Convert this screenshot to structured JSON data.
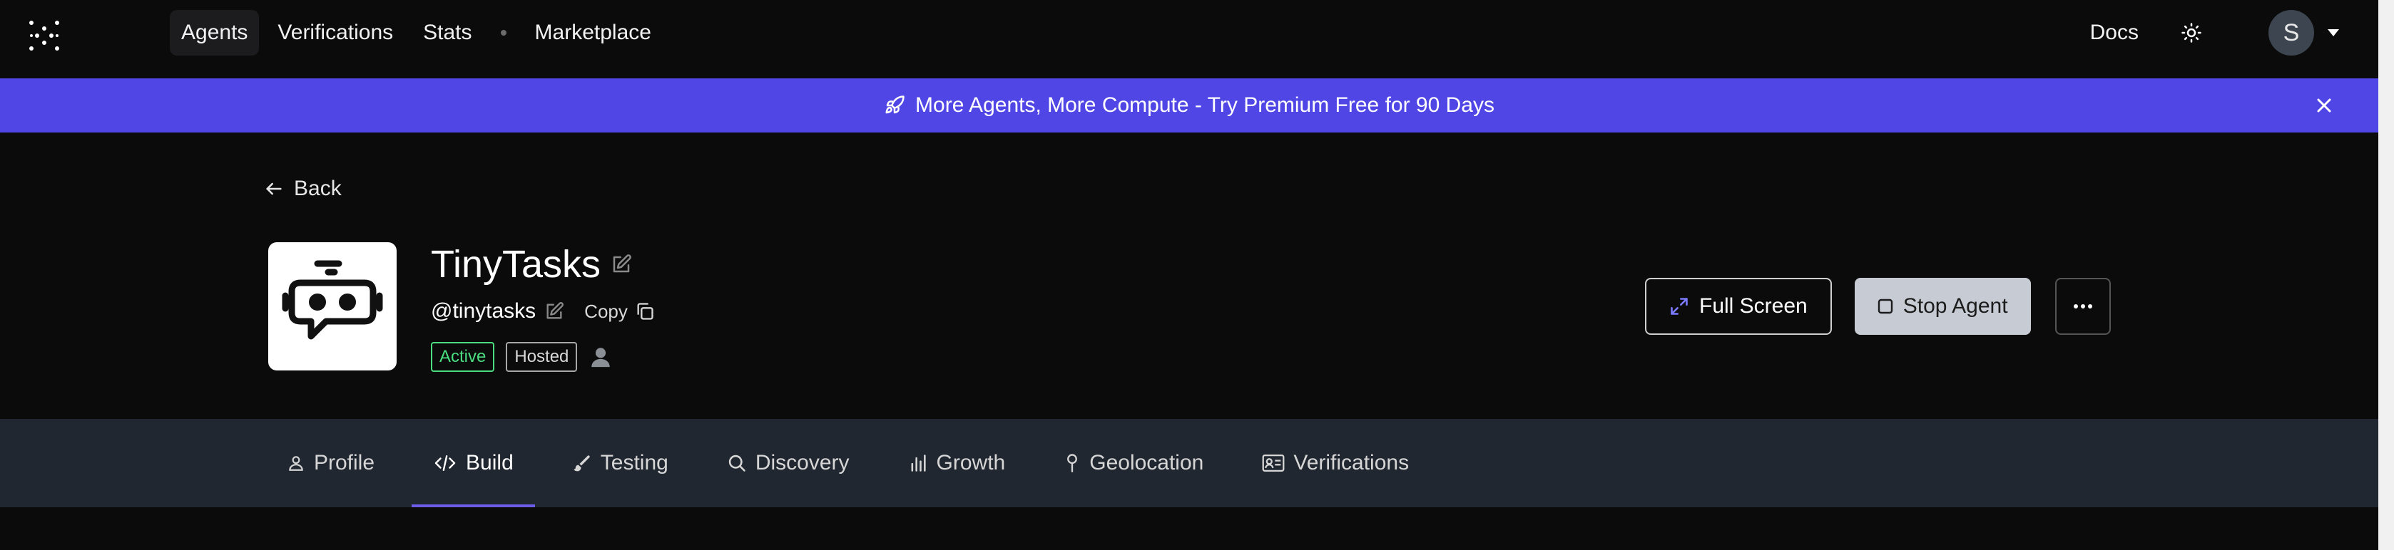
{
  "nav": {
    "links": [
      {
        "label": "Agents",
        "active": true
      },
      {
        "label": "Verifications",
        "active": false
      },
      {
        "label": "Stats",
        "active": false
      },
      {
        "label": "Marketplace",
        "active": false
      }
    ],
    "docs_label": "Docs",
    "theme_icon": "sun-icon",
    "avatar_initial": "S"
  },
  "banner": {
    "text": "More Agents, More Compute - Try Premium Free for 90 Days",
    "icon": "rocket-icon",
    "background": "#5046e5"
  },
  "header": {
    "back_label": "Back",
    "agent_name": "TinyTasks",
    "handle": "@tinytasks",
    "copy_label": "Copy",
    "badges": [
      {
        "label": "Active",
        "color": "#4ade80"
      },
      {
        "label": "Hosted",
        "color": "#d8d8d8"
      }
    ]
  },
  "actions": {
    "full_screen_label": "Full Screen",
    "stop_agent_label": "Stop Agent"
  },
  "tabs": [
    {
      "label": "Profile",
      "icon": "user-icon",
      "active": false
    },
    {
      "label": "Build",
      "icon": "code-icon",
      "active": true
    },
    {
      "label": "Testing",
      "icon": "brush-icon",
      "active": false
    },
    {
      "label": "Discovery",
      "icon": "search-icon",
      "active": false
    },
    {
      "label": "Growth",
      "icon": "bar-chart-icon",
      "active": false
    },
    {
      "label": "Geolocation",
      "icon": "map-pin-icon",
      "active": false
    },
    {
      "label": "Verifications",
      "icon": "id-card-icon",
      "active": false
    }
  ],
  "colors": {
    "accent": "#6c5ce7",
    "page_bg": "#0b0b0b",
    "tabbar_bg": "#212730"
  }
}
